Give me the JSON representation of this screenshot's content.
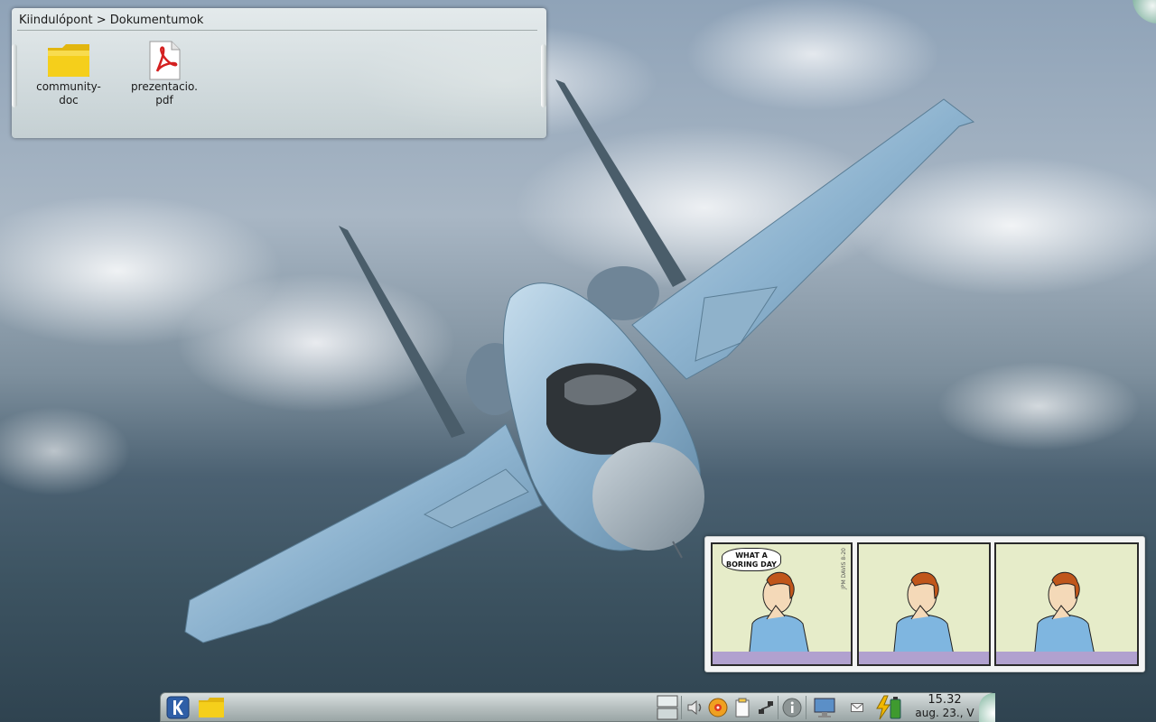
{
  "folder_view": {
    "breadcrumb": "Kiindulópont > Dokumentumok",
    "items": [
      {
        "line1": "community-",
        "line2": "doc",
        "icon": "folder-icon"
      },
      {
        "line1": "prezentacio.",
        "line2": "pdf",
        "icon": "pdf-icon"
      }
    ]
  },
  "comic": {
    "bubble_line1": "WHAT A",
    "bubble_line2": "BORING DAY",
    "date_text": "JPM DAVIS 8-20",
    "colors": {
      "panel": "#e6ecc9",
      "floor": "#b1a1cf",
      "shirt": "#7fb6e0",
      "hair": "#c0561b"
    }
  },
  "taskbar": {
    "launcher_icon": "kde-launcher-icon",
    "file_manager_icon": "folder-icon",
    "pager_icon": "pager-icon",
    "tray_icons": [
      "speaker-icon",
      "media-player-icon",
      "clipboard-icon",
      "network-icon",
      "info-icon",
      "display-icon",
      "mail-icon",
      "battery-icon"
    ],
    "clock_time": "15.32",
    "clock_date": "aug. 23., V"
  },
  "colors": {
    "panel_top": "#d9dfdf",
    "panel_bottom": "#9aa5a5",
    "toolbox": "#6aa58f",
    "folder_yellow": "#f5cf1b",
    "pdf_red": "#d42020"
  }
}
